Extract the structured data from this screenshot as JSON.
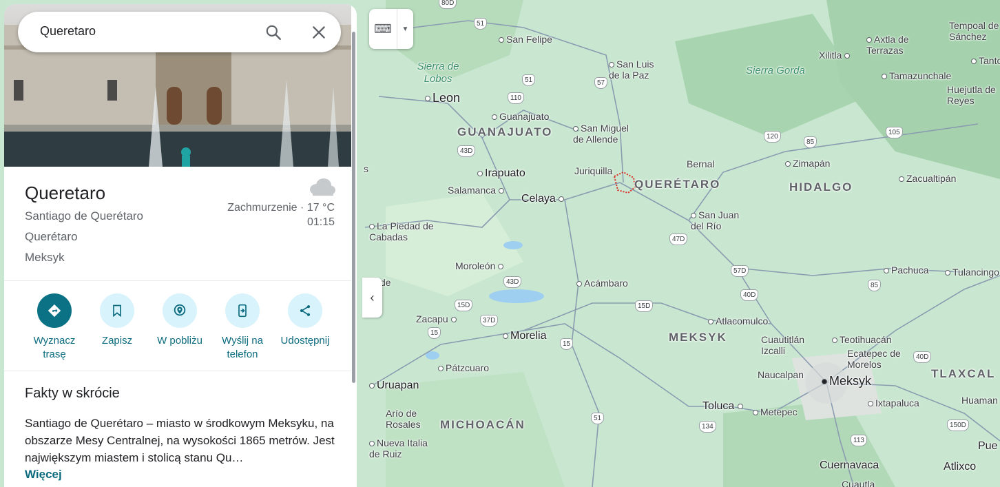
{
  "search": {
    "query": "Queretaro"
  },
  "place": {
    "title": "Queretaro",
    "address": [
      "Santiago de Querétaro",
      "Querétaro",
      "Meksyk"
    ],
    "weather": {
      "text": "Zachmurzenie · 17 °C",
      "time": "01:15",
      "icon": "cloud-icon"
    }
  },
  "actions": [
    {
      "label": "Wyznacz trasę",
      "icon": "directions-icon"
    },
    {
      "label": "Zapisz",
      "icon": "bookmark-icon"
    },
    {
      "label": "W pobliżu",
      "icon": "nearby-icon"
    },
    {
      "label": "Wyślij na telefon",
      "icon": "send-to-phone-icon"
    },
    {
      "label": "Udostępnij",
      "icon": "share-icon"
    }
  ],
  "facts": {
    "title": "Fakty w skrócie",
    "text": "Santiago de Querétaro – miasto w środkowym Meksyku, na obszarze Mesy Centralnej, na wysokości 1865 metrów. Jest największym miastem i stolicą stanu Qu…",
    "more": "Więcej"
  },
  "map": {
    "regions": [
      "GUANAJUATO",
      "QUERÉTARO",
      "HIDALGO",
      "MEKSYK",
      "MICHOACÁN",
      "TLAXCAL"
    ],
    "cities": [
      "Leon",
      "Irapuato",
      "Celaya",
      "Morelia",
      "Uruapan",
      "Toluca",
      "Meksyk",
      "Cuernavaca",
      "Atlixco",
      "Pue"
    ],
    "places": [
      "San Felipe",
      "San Luis de la Paz",
      "Guanajuato",
      "San Miguel de Allende",
      "Juriquilla",
      "Salamanca",
      "Bernal",
      "Zimapán",
      "Zacualtipán",
      "San Juan del Río",
      "La Piedad de Cabadas",
      "Moroleón",
      "Acámbaro",
      "Zacapu",
      "Pátzcuaro",
      "Atlacomulco",
      "Cuautitlán Izcalli",
      "Teotihuacán",
      "Ecatepec de Morelos",
      "Naucalpan",
      "Metepec",
      "Ixtapaluca",
      "Pachuca",
      "Tulancingo",
      "Huejutla de Reyes",
      "Tamazunchale",
      "Xilitla",
      "Axtla de Terrazas",
      "Tempoal de Sánchez",
      "Tanto",
      "Arío de Rosales",
      "Nueva Italia de Ruiz",
      "Huaman",
      "Cuautla",
      "de",
      "s"
    ],
    "nature": [
      "Sierra de Lobos",
      "Sierra Gorda"
    ],
    "roads": [
      "80D",
      "51",
      "51",
      "57",
      "110",
      "43D",
      "120",
      "85",
      "105",
      "47D",
      "57D",
      "40D",
      "85",
      "43D",
      "15D",
      "15D",
      "37D",
      "15",
      "15",
      "51",
      "134",
      "113",
      "40D",
      "150D"
    ]
  },
  "controls": {
    "keyboard": "keyboard-icon",
    "collapse": "chevron-left-icon"
  }
}
